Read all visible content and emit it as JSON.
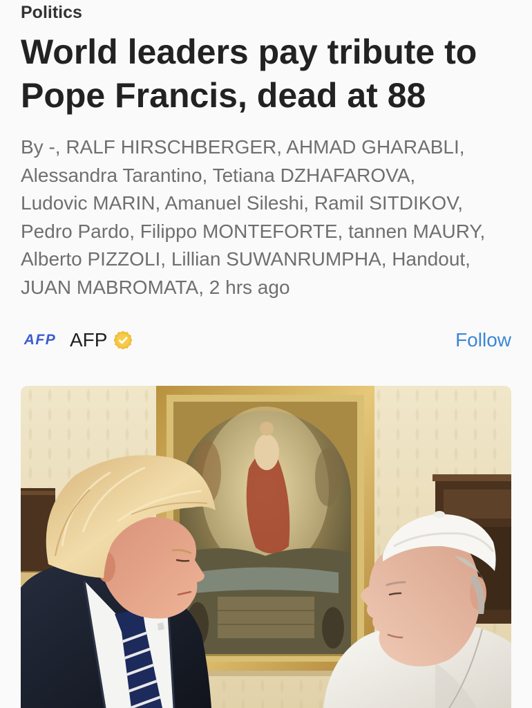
{
  "article": {
    "category": "Politics",
    "headline": "World leaders pay tribute to Pope Francis, dead at 88",
    "byline": {
      "lines": [
        "By -, RALF HIRSCHBERGER, AHMAD GHARABLI,",
        "Alessandra Tarantino, Tetiana DZHAFAROVA,",
        "Ludovic MARIN, Amanuel Sileshi, Ramil SITDIKOV,",
        "Pedro Pardo, Filippo MONTEFORTE, tannen MAURY,",
        "Alberto PIZZOLI, Lillian SUWANRUMPHA, Handout,",
        "JUAN MABROMATA,"
      ],
      "timestamp": "2 hrs ago"
    },
    "publisher": {
      "logo_text": "AFP",
      "logo_icon": "afp-logo",
      "name": "AFP",
      "verified_icon": "verified-badge-icon",
      "follow_label": "Follow"
    }
  },
  "colors": {
    "page_bg": "#fafafa",
    "category_text": "#333333",
    "headline_text": "#222222",
    "byline_text": "#6f6f6f",
    "publisher_text": "#1f1f1f",
    "afp_logo_blue": "#3d5bd1",
    "link_blue": "#3b86d9",
    "verified_gold": "#f4c43c"
  }
}
